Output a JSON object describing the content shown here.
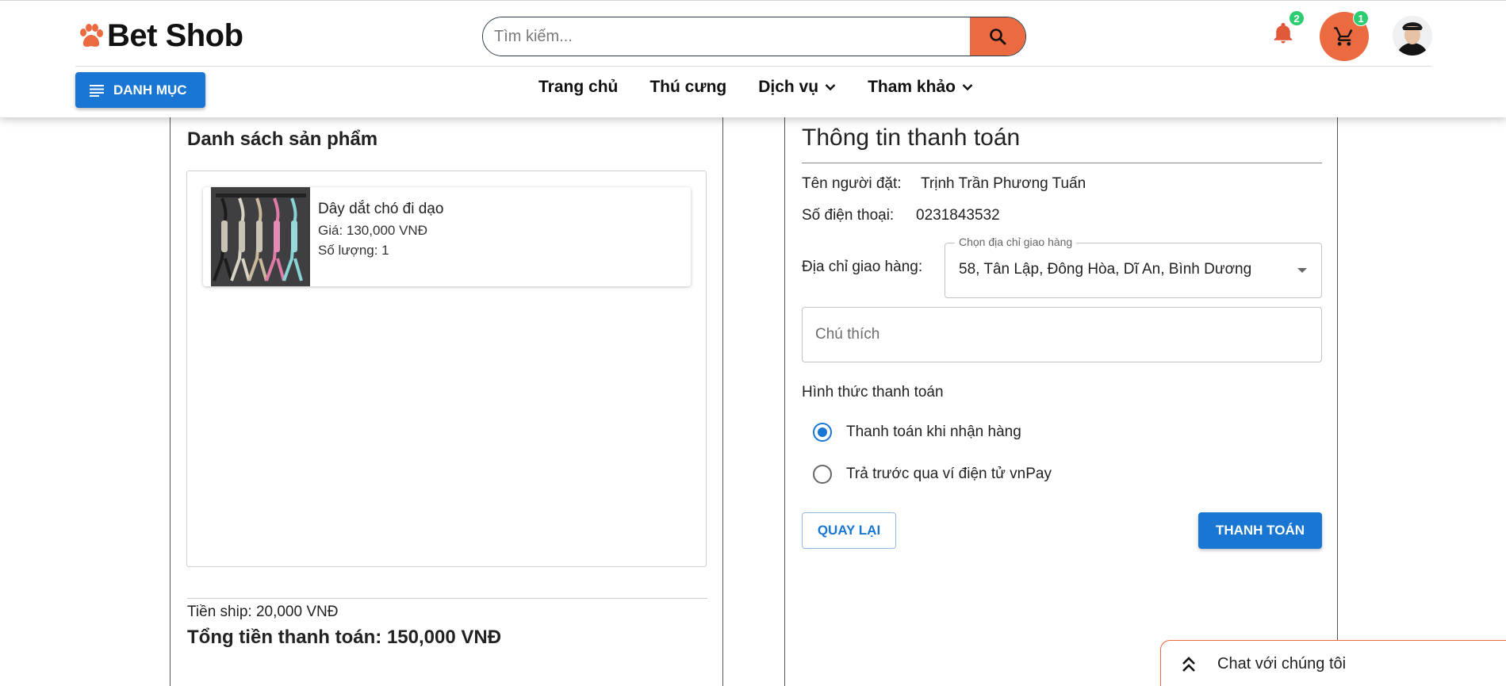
{
  "header": {
    "brand": "Bet Shob",
    "search": {
      "placeholder": "Tìm kiếm..."
    },
    "notifications": {
      "count": "2"
    },
    "cart": {
      "count": "1"
    },
    "menu_button": "DANH MỤC",
    "nav": [
      "Trang chủ",
      "Thú cưng",
      "Dịch vụ",
      "Tham khảo"
    ]
  },
  "left_panel": {
    "title": "Danh sách sản phẩm",
    "products": [
      {
        "name": "Dây dắt chó đi dạo",
        "price": "Giá: 130,000 VNĐ",
        "quantity": "Số lượng: 1"
      }
    ],
    "shipping": "Tiền ship: 20,000 VNĐ",
    "total": "Tổng tiền thanh toán: 150,000 VNĐ"
  },
  "right_panel": {
    "title": "Thông tin thanh toán",
    "buyer_label": "Tên người đặt:",
    "buyer_value": "Trịnh Trần Phương Tuấn",
    "phone_label": "Số điện thoại:",
    "phone_value": "0231843532",
    "address_label": "Địa chỉ giao hàng:",
    "address_legend": "Chọn địa chỉ giao hàng",
    "address_value": "58, Tân Lập, Đông Hòa, Dĩ An, Bình Dương",
    "note_placeholder": "Chú thích",
    "method_label": "Hình thức thanh toán",
    "methods": [
      "Thanh toán khi nhận hàng",
      "Trả trước qua ví điện tử vnPay"
    ],
    "back_button": "QUAY LẠI",
    "pay_button": "THANH TOÁN"
  },
  "chat": {
    "label": "Chat với chúng tôi"
  },
  "colors": {
    "accent": "#ec6a3f",
    "primary": "#1976d2",
    "badge": "#2ecc71"
  },
  "icons": [
    "paw-icon",
    "search-icon",
    "bell-icon",
    "cart-icon",
    "menu-icon",
    "chevron-down-icon",
    "chevrons-up-icon"
  ]
}
